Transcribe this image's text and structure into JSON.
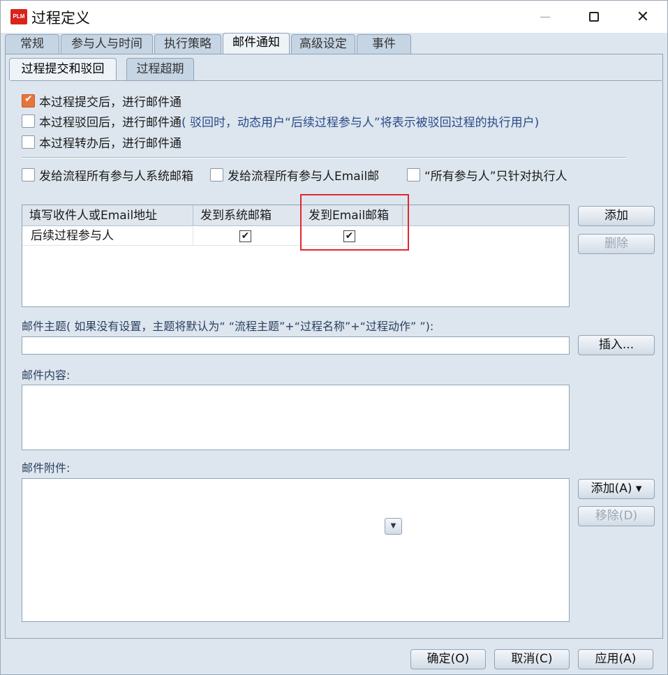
{
  "window": {
    "icon_text": "PLM",
    "title": "过程定义",
    "minimize": "—",
    "maximize": "□",
    "close": "✕"
  },
  "tabs": [
    "常规",
    "参与人与时间",
    "执行策略",
    "邮件通知",
    "高级设定",
    "事件"
  ],
  "active_tab": "邮件通知",
  "subtabs": [
    "过程提交和驳回",
    "过程超期"
  ],
  "active_subtab": "过程提交和驳回",
  "notify_options": [
    {
      "label": "本过程提交后，进行邮件通",
      "checked": true
    },
    {
      "label": "本过程驳回后，进行邮件通",
      "hint": "( 驳回时，动态用户“后续过程参与人”将表示被驳回过程的执行用户)",
      "checked": false
    },
    {
      "label": "本过程转办后，进行邮件通",
      "checked": false
    }
  ],
  "send_options": [
    {
      "label": "发给流程所有参与人系统邮箱",
      "checked": false
    },
    {
      "label": "发给流程所有参与人Email邮",
      "checked": false
    },
    {
      "label": "“所有参与人”只针对执行人",
      "checked": false
    }
  ],
  "recipients": {
    "columns": [
      "填写收件人或Email地址",
      "发到系统邮箱",
      "发到Email邮箱"
    ],
    "rows": [
      {
        "name": "后续过程参与人",
        "system": true,
        "email": true
      }
    ]
  },
  "buttons": {
    "add": "添加",
    "delete": "删除",
    "insert": "插入...",
    "attach_add": "添加(A) ▾",
    "attach_remove": "移除(D)",
    "ok": "确定(O)",
    "cancel": "取消(C)",
    "apply": "应用(A)"
  },
  "labels": {
    "subject": "邮件主题( 如果没有设置，主题将默认为“ “流程主题”+“过程名称”+“过程动作” ”):",
    "content": "邮件内容:",
    "attachment": "邮件附件:"
  },
  "fields": {
    "subject_value": "",
    "content_value": ""
  },
  "colors": {
    "accent_checkbox": "#e8743b",
    "highlight": "#e3262d"
  }
}
